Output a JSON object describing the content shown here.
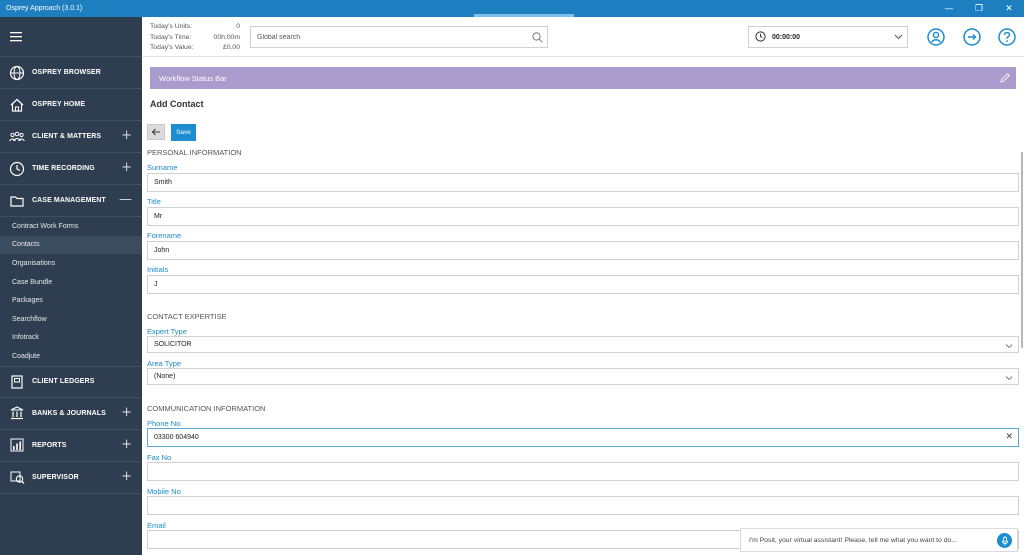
{
  "window": {
    "title": "Osprey Approach (3.0.1)",
    "minimize": "—",
    "restore": "❐",
    "close": "✕"
  },
  "sidebar": {
    "sections": [
      {
        "label": "OSPREY BROWSER",
        "icon": "globe-icon",
        "expand": ""
      },
      {
        "label": "OSPREY HOME",
        "icon": "home-icon",
        "expand": ""
      },
      {
        "label": "CLIENT & MATTERS",
        "icon": "people-icon",
        "expand": "+"
      },
      {
        "label": "TIME RECORDING",
        "icon": "clock-icon",
        "expand": "+"
      },
      {
        "label": "CASE MANAGEMENT",
        "icon": "folder-icon",
        "expand": "—"
      }
    ],
    "sub_items": [
      "Contract Work Forms",
      "Contacts",
      "Organisations",
      "Case Bundle",
      "Packages",
      "Searchflow",
      "Infotrack",
      "Coadjute"
    ],
    "sections_after": [
      {
        "label": "CLIENT LEDGERS",
        "icon": "ledger-icon",
        "expand": ""
      },
      {
        "label": "BANKS & JOURNALS",
        "icon": "bank-icon",
        "expand": "+"
      },
      {
        "label": "REPORTS",
        "icon": "chart-icon",
        "expand": "+"
      },
      {
        "label": "SUPERVISOR",
        "icon": "supervisor-icon",
        "expand": "+"
      }
    ]
  },
  "topbar": {
    "stats": [
      {
        "label": "Today's Units:",
        "value": "0"
      },
      {
        "label": "Today's Time:",
        "value": "00h:00m"
      },
      {
        "label": "Today's Value:",
        "value": "£0.00"
      }
    ],
    "search_placeholder": "Global search",
    "timer_value": "00:00:00"
  },
  "content": {
    "workflow_bar": "Workflow Status Bar",
    "page_title": "Add Contact",
    "save_label": "Save",
    "personal_heading": "PERSONAL INFORMATION",
    "fields": {
      "surname": {
        "label": "Surname",
        "value": "Smith"
      },
      "title": {
        "label": "Title",
        "value": "Mr"
      },
      "forename": {
        "label": "Forename",
        "value": "John"
      },
      "initials": {
        "label": "Initials",
        "value": "J"
      }
    },
    "expertise_heading": "CONTACT EXPERTISE",
    "expert_type": {
      "label": "Expert Type",
      "value": "SOLICITOR"
    },
    "area_type": {
      "label": "Area Type",
      "value": "(None)"
    },
    "communication_heading": "COMMUNICATION INFORMATION",
    "phone": {
      "label": "Phone No",
      "value": "03300 604940"
    },
    "fax": {
      "label": "Fax No",
      "value": ""
    },
    "mobile": {
      "label": "Mobile No",
      "value": ""
    },
    "email": {
      "label": "Email",
      "value": ""
    }
  },
  "assistant": {
    "text": "I'm Posit, your virtual assistant! Please, tell me what you want to do..."
  },
  "colors": {
    "titlebar": "#1e7fc0",
    "sidebar": "#2e3d4f",
    "accent": "#1b8dd0",
    "workflow_bar": "#a99bcc",
    "field_label": "#1a8bc9"
  }
}
